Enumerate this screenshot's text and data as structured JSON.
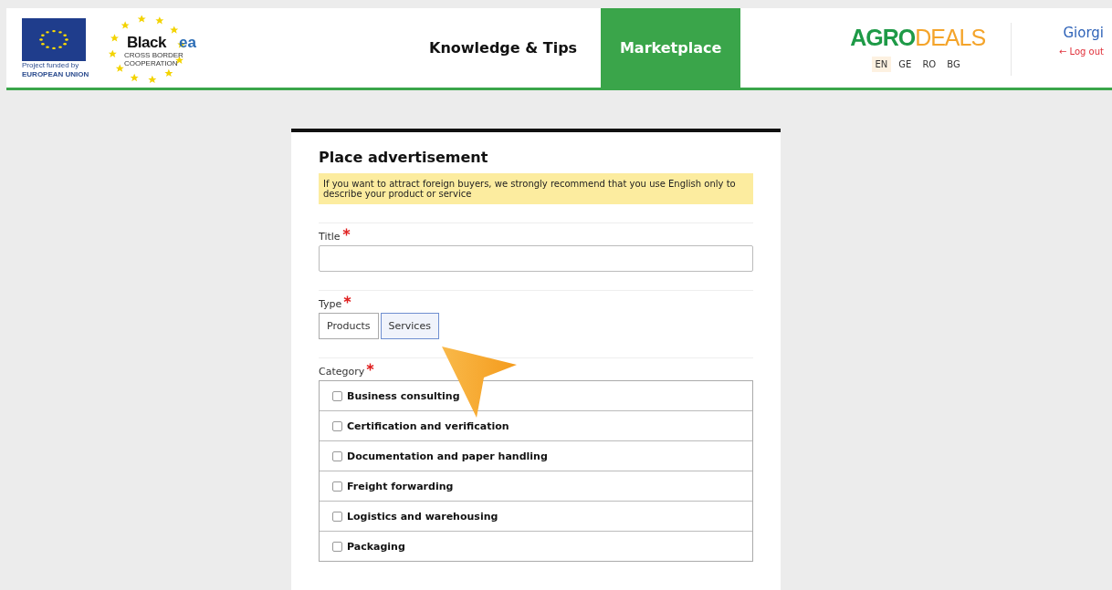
{
  "header": {
    "eu_logo": {
      "caption_1": "Project funded by",
      "caption_2": "EUROPEAN UNION"
    },
    "blacksea_logo": {
      "word_1": "Black",
      "word_2": "ea",
      "subtitle_1": "CROSS BORDER",
      "subtitle_2": "COOPERATION"
    },
    "nav": [
      {
        "label": "Knowledge & Tips",
        "selected": false
      },
      {
        "label": "Marketplace",
        "selected": true
      }
    ],
    "brand": {
      "part_1": "AGRO",
      "part_2": "DEALS"
    },
    "languages": [
      {
        "label": "EN",
        "selected": true
      },
      {
        "label": "GE",
        "selected": false
      },
      {
        "label": "RO",
        "selected": false
      },
      {
        "label": "BG",
        "selected": false
      }
    ],
    "user": {
      "name": "Giorgi",
      "logout": "← Log out"
    }
  },
  "form": {
    "title": "Place advertisement",
    "notice": "If you want to attract foreign buyers, we strongly recommend that you use English only to describe your product or service",
    "title_field": {
      "label": "Title",
      "required": true
    },
    "type_field": {
      "label": "Type",
      "required": true,
      "options": [
        {
          "label": "Products",
          "selected": false
        },
        {
          "label": "Services",
          "selected": true
        }
      ]
    },
    "category_field": {
      "label": "Category",
      "required": true,
      "options": [
        {
          "label": "Business consulting",
          "checked": false
        },
        {
          "label": "Certification and verification",
          "checked": false
        },
        {
          "label": "Documentation and paper handling",
          "checked": false
        },
        {
          "label": "Freight forwarding",
          "checked": false
        },
        {
          "label": "Logistics and warehousing",
          "checked": false
        },
        {
          "label": "Packaging",
          "checked": false
        }
      ]
    }
  }
}
